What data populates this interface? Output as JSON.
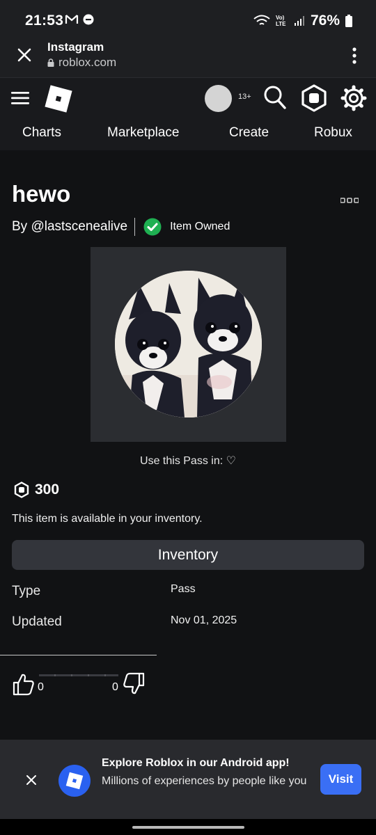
{
  "status_bar": {
    "time": "21:53",
    "battery": "76%",
    "network_label": "Vo) LTE"
  },
  "browser": {
    "title": "Instagram",
    "url": "roblox.com"
  },
  "header": {
    "age_badge": "13+",
    "tabs": [
      {
        "label": "Charts"
      },
      {
        "label": "Marketplace"
      },
      {
        "label": "Create"
      },
      {
        "label": "Robux"
      }
    ]
  },
  "item": {
    "title": "hewo",
    "creator": "By @lastscenealive",
    "owned_label": "Item Owned",
    "use_pass_text": "Use this Pass in: ♡",
    "price": "300",
    "availability": "This item is available in your inventory.",
    "inventory_button": "Inventory",
    "details": [
      {
        "label": "Type",
        "value": "Pass"
      },
      {
        "label": "Updated",
        "value": "Nov 01, 2025"
      }
    ],
    "upvotes": "0",
    "downvotes": "0"
  },
  "app_banner": {
    "title": "Explore Roblox in our Android app!",
    "subtitle": "Millions of experiences by people like you",
    "visit_label": "Visit"
  },
  "colors": {
    "background": "#111214",
    "owned_green": "#1fb052",
    "visit_blue": "#3a6ff5"
  }
}
